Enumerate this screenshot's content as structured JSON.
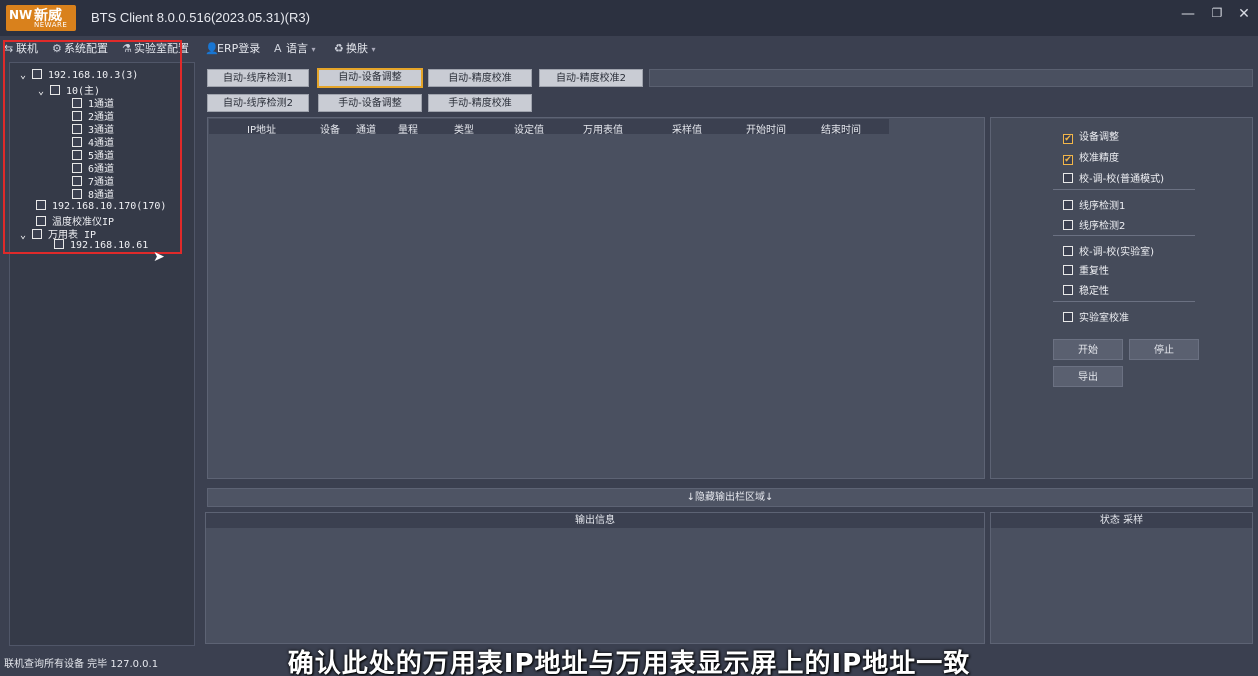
{
  "window": {
    "logo_mark": "NW",
    "logo_cn": "新威",
    "logo_en": "NEWARE",
    "title": "BTS Client 8.0.0.516(2023.05.31)(R3)",
    "minimize": "—",
    "restore": "❐",
    "close": "✕"
  },
  "menu": [
    {
      "icon": "⇆",
      "label": "联机"
    },
    {
      "icon": "⚙",
      "label": "系统配置"
    },
    {
      "icon": "⚗",
      "label": "实验室配置"
    },
    {
      "icon": "👤",
      "label": "ERP登录"
    },
    {
      "icon": "A",
      "label": "语言"
    },
    {
      "icon": "♻",
      "label": "换肤"
    }
  ],
  "tree": {
    "device1": "192.168.10.3(3)",
    "unit": "10(主)",
    "channels": [
      "1通道",
      "2通道",
      "3通道",
      "4通道",
      "5通道",
      "6通道",
      "7通道",
      "8通道"
    ],
    "device2": "192.168.10.170(170)",
    "temp_ip": "温度校准仪IP",
    "meter_ip": "万用表  IP",
    "meter_addr": "192.168.10.61"
  },
  "tabs": {
    "row1": [
      "自动-线序检测1",
      "自动-设备调整",
      "自动-精度校准",
      "自动-精度校准2"
    ],
    "row2": [
      "自动-线序检测2",
      "手动-设备调整",
      "手动-精度校准"
    ],
    "active": "自动-设备调整"
  },
  "grid": {
    "columns": [
      "IP地址",
      "设备",
      "通道",
      "量程",
      "类型",
      "设定值",
      "万用表值",
      "采样值",
      "开始时间",
      "结束时间"
    ]
  },
  "options": {
    "items": [
      {
        "label": "设备调整",
        "checked": "✔"
      },
      {
        "label": "校准精度",
        "checked": "✔"
      },
      {
        "label": "校-调-校(普通模式)",
        "checked": ""
      },
      {
        "label": "线序检测1",
        "checked": ""
      },
      {
        "label": "线序检测2",
        "checked": ""
      },
      {
        "label": "校-调-校(实验室)",
        "checked": ""
      },
      {
        "label": "重复性",
        "checked": ""
      },
      {
        "label": "稳定性",
        "checked": ""
      },
      {
        "label": "实验室校准",
        "checked": ""
      }
    ],
    "start": "开始",
    "stop": "停止",
    "export": "导出"
  },
  "output": {
    "hide_bar": "↓隐藏输出栏区域↓",
    "info_header": "输出信息",
    "status_header": "状态 采样"
  },
  "statusbar": "联机查询所有设备 完毕 127.0.0.1",
  "subtitle": "确认此处的万用表IP地址与万用表显示屏上的IP地址一致"
}
